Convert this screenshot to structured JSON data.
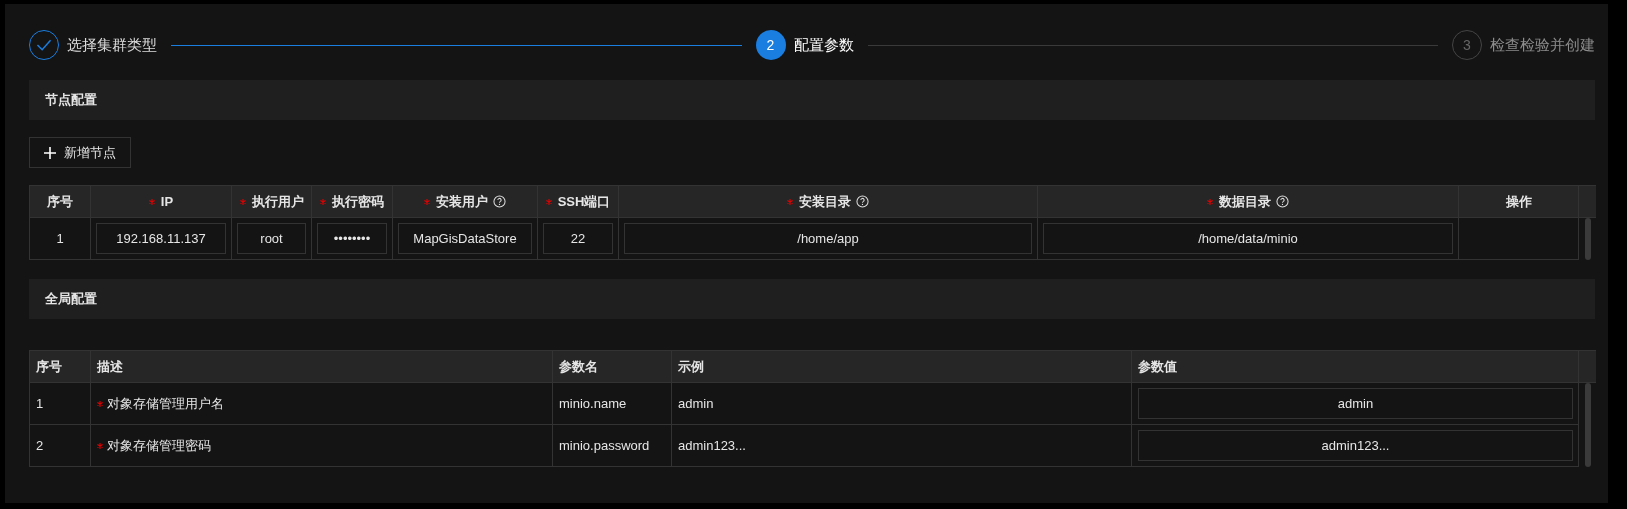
{
  "steps": [
    {
      "label": "选择集群类型",
      "completed": true,
      "selected": false
    },
    {
      "label": "配置参数",
      "number": "2",
      "completed": false,
      "selected": true
    },
    {
      "label": "检查检验并创建",
      "number": "3",
      "completed": false,
      "selected": false
    }
  ],
  "node_section": {
    "title": "节点配置",
    "add_button": "新增节点",
    "table": {
      "columns": [
        {
          "label": "序号",
          "required": false,
          "help": false
        },
        {
          "label": "IP",
          "required": true,
          "help": false
        },
        {
          "label": "执行用户",
          "required": true,
          "help": false
        },
        {
          "label": "执行密码",
          "required": true,
          "help": false
        },
        {
          "label": "安装用户",
          "required": true,
          "help": true
        },
        {
          "label": "SSH端口",
          "required": true,
          "help": false
        },
        {
          "label": "安装目录",
          "required": true,
          "help": true
        },
        {
          "label": "数据目录",
          "required": true,
          "help": true
        },
        {
          "label": "操作",
          "required": false,
          "help": false
        }
      ],
      "rows": [
        [
          {
            "kind": "text",
            "value": "1"
          },
          {
            "kind": "input",
            "value": "192.168.11.137"
          },
          {
            "kind": "input",
            "value": "root"
          },
          {
            "kind": "input",
            "value": "••••••••"
          },
          {
            "kind": "input",
            "value": "MapGisDataStore"
          },
          {
            "kind": "input",
            "value": "22"
          },
          {
            "kind": "input",
            "value": "/home/app"
          },
          {
            "kind": "input",
            "value": "/home/data/minio"
          },
          {
            "kind": "empty"
          }
        ]
      ]
    }
  },
  "global_section": {
    "title": "全局配置",
    "table": {
      "columns": [
        {
          "label": "序号",
          "required": false,
          "help": false
        },
        {
          "label": "描述",
          "required": false,
          "help": false
        },
        {
          "label": "参数名",
          "required": false,
          "help": false
        },
        {
          "label": "示例",
          "required": false,
          "help": false
        },
        {
          "label": "参数值",
          "required": false,
          "help": false
        }
      ],
      "rows": [
        [
          {
            "kind": "text",
            "value": "1"
          },
          {
            "kind": "required-text",
            "value": "对象存储管理用户名"
          },
          {
            "kind": "text",
            "value": "minio.name"
          },
          {
            "kind": "text",
            "value": "admin"
          },
          {
            "kind": "input",
            "value": "admin"
          }
        ],
        [
          {
            "kind": "text",
            "value": "2"
          },
          {
            "kind": "required-text",
            "value": "对象存储管理密码"
          },
          {
            "kind": "text",
            "value": "minio.password"
          },
          {
            "kind": "text",
            "value": "admin123..."
          },
          {
            "kind": "input",
            "value": "admin123..."
          }
        ]
      ]
    }
  }
}
